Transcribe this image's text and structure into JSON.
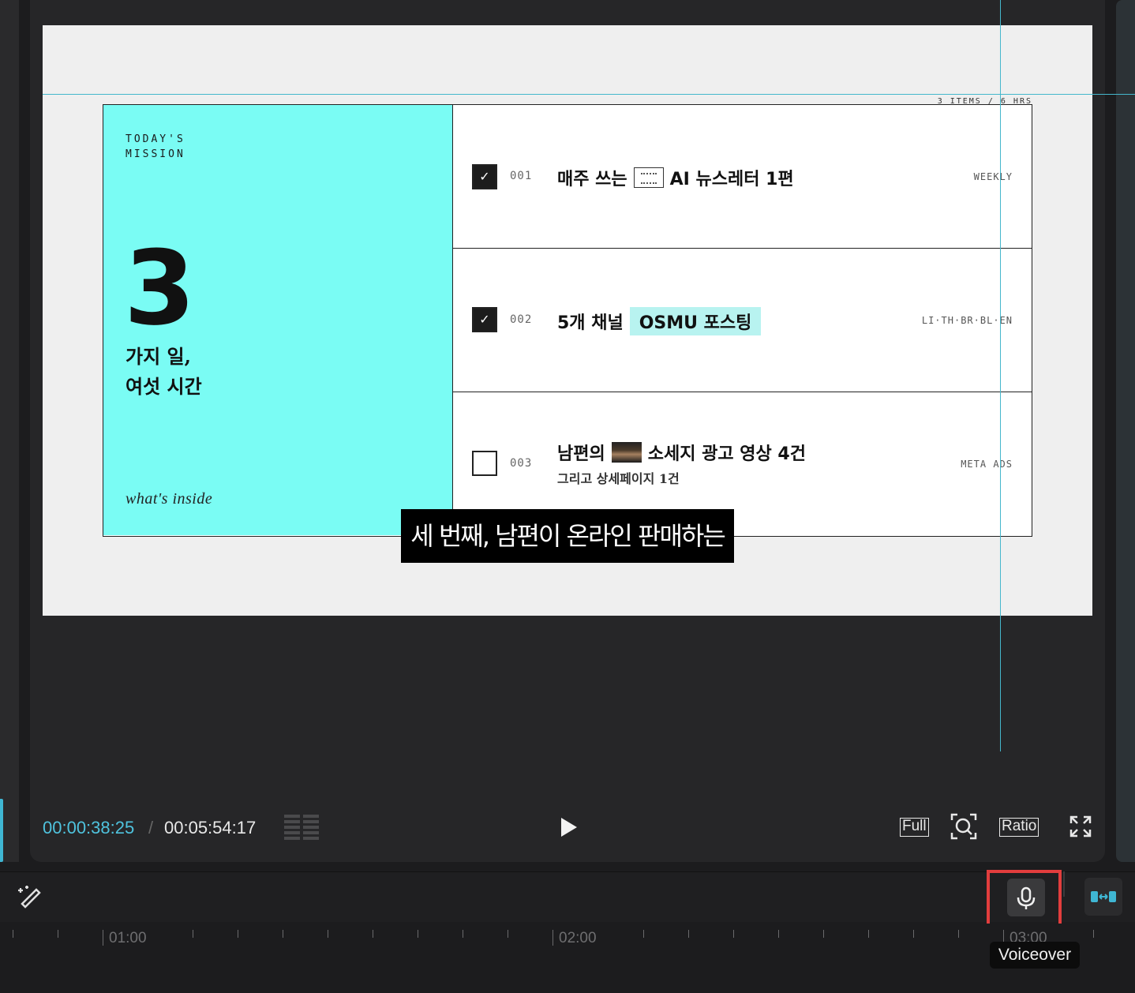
{
  "preview": {
    "items_note": "3 ITEMS / 6 HRS",
    "mission": {
      "label_line1": "TODAY'S",
      "label_line2": "MISSION",
      "big_number": "3",
      "sub_line1": "가지 일,",
      "sub_line2": "여섯 시간",
      "inside": "what's inside"
    },
    "tasks": [
      {
        "num": "001",
        "checked": true,
        "title_a": "매주 쓰는",
        "thumb": "newsletter-thumbnail",
        "title_b": "AI 뉴스레터 1편",
        "tag": "WEEKLY",
        "check_glyph": "✓"
      },
      {
        "num": "002",
        "checked": true,
        "title_a": "5개 채널",
        "title_highlight": "OSMU 포스팅",
        "tag": "LI·TH·BR·BL·EN",
        "check_glyph": "✓"
      },
      {
        "num": "003",
        "checked": false,
        "title_a": "남편의",
        "thumb": "video-thumbnail",
        "title_b": "소세지 광고 영상 4건",
        "sub": "그리고 상세페이지 1건",
        "tag": "META ADS",
        "check_glyph": ""
      }
    ],
    "subtitle": "세 번째, 남편이 온라인 판매하는"
  },
  "player_controls": {
    "time_current": "00:00:38:25",
    "time_separator": "/",
    "time_total": "00:05:54:17",
    "full_label": "Full",
    "ratio_label": "Ratio"
  },
  "timeline": {
    "ruler_labels": [
      "01:00",
      "02:00",
      "03:00"
    ]
  },
  "tooltip": {
    "voiceover": "Voiceover"
  },
  "colors": {
    "accent": "#4fc3de",
    "mission_panel": "#7afcf4",
    "highlight_box": "#e23d3d",
    "link_icon": "#3fb6d3"
  }
}
